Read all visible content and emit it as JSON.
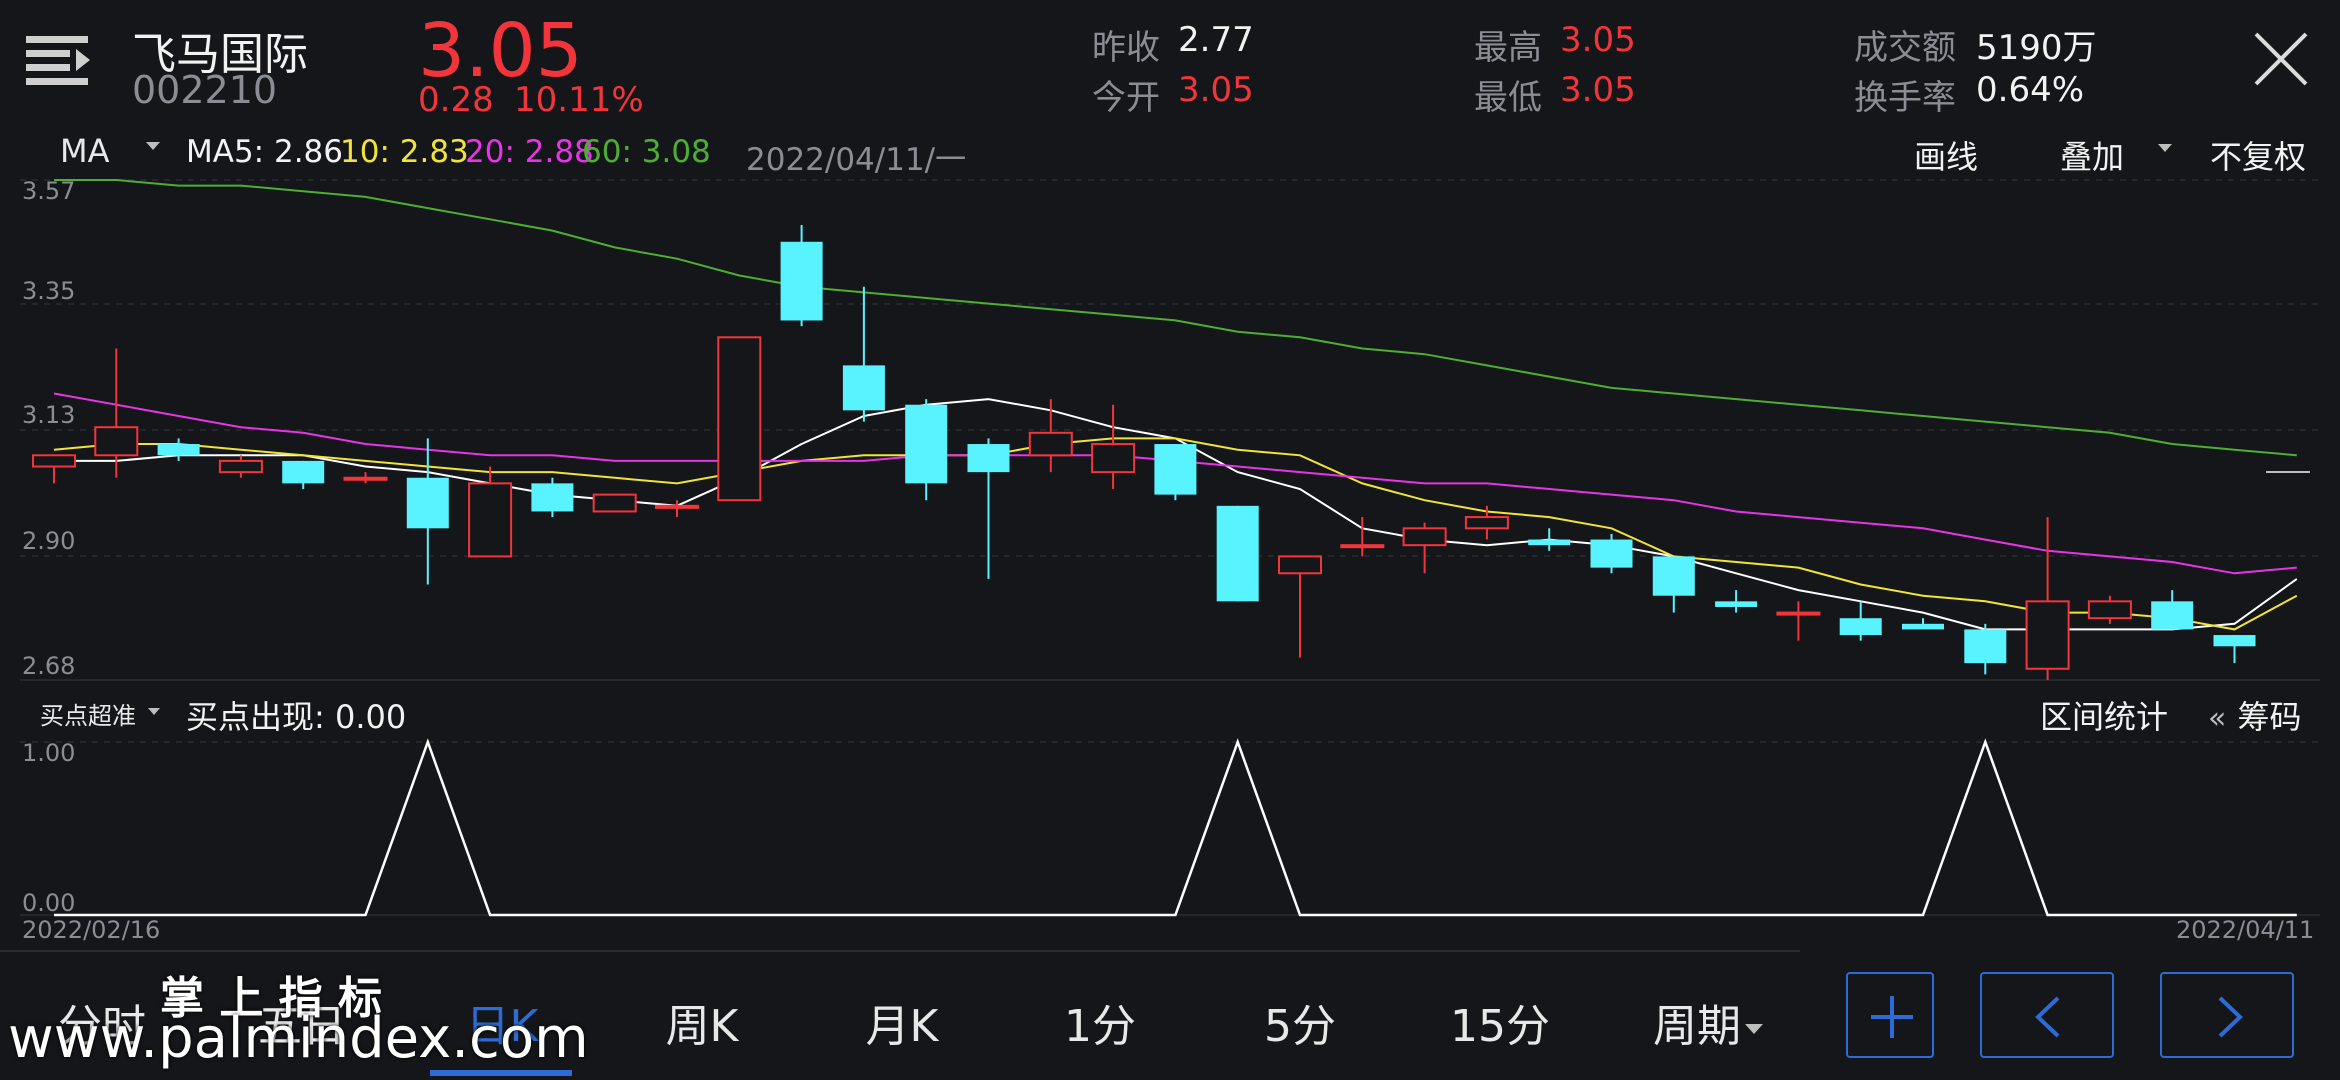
{
  "stock": {
    "name": "飞马国际",
    "code": "002210",
    "price": "3.05",
    "change": "0.28",
    "change_pct": "10.11%"
  },
  "quote": {
    "prev_close_label": "昨收",
    "prev_close": "2.77",
    "open_label": "今开",
    "open": "3.05",
    "high_label": "最高",
    "high": "3.05",
    "low_label": "最低",
    "low": "3.05",
    "amount_label": "成交额",
    "amount": "5190万",
    "turnover_label": "换手率",
    "turnover": "0.64%"
  },
  "toolbar": {
    "indicator": "MA",
    "ma5": "MA5: 2.86",
    "ma10": "10: 2.83",
    "ma20": "20: 2.88",
    "ma60": "60: 3.08",
    "date": "2022/04/11/一",
    "draw_label": "画线",
    "overlay_label": "叠加",
    "adjust_label": "不复权"
  },
  "sub_toolbar": {
    "indicator": "买点超准",
    "value_label": "买点出现: 0.00",
    "range_stats": "区间统计",
    "chips": "筹码",
    "chips_arrow": "«"
  },
  "axis": {
    "y_ticks": [
      "3.57",
      "3.35",
      "3.13",
      "2.90",
      "2.68"
    ],
    "sub_ticks": [
      "1.00",
      "0.00"
    ],
    "start_date": "2022/02/16",
    "end_date": "2022/04/11"
  },
  "tabs": [
    "分时",
    "五日",
    "日K",
    "周K",
    "月K",
    "1分",
    "5分",
    "15分",
    "周期"
  ],
  "active_tab": "日K",
  "watermark": {
    "line1": "掌 上 指 标",
    "line2": "www.palmindex.com"
  },
  "colors": {
    "up": "#f2353a",
    "down": "#59f3ff",
    "ma5": "#ffffff",
    "ma10": "#f0e43a",
    "ma20": "#e635e6",
    "ma60": "#4caf32",
    "accent": "#2d6bd6"
  },
  "chart_data": {
    "type": "candlestick",
    "ylim": [
      2.68,
      3.57
    ],
    "candles": [
      {
        "o": 3.06,
        "h": 3.08,
        "l": 3.03,
        "c": 3.08
      },
      {
        "o": 3.08,
        "h": 3.27,
        "l": 3.04,
        "c": 3.13
      },
      {
        "o": 3.1,
        "h": 3.11,
        "l": 3.07,
        "c": 3.08
      },
      {
        "o": 3.05,
        "h": 3.08,
        "l": 3.04,
        "c": 3.07
      },
      {
        "o": 3.07,
        "h": 3.07,
        "l": 3.02,
        "c": 3.03
      },
      {
        "o": 3.04,
        "h": 3.05,
        "l": 3.03,
        "c": 3.04
      },
      {
        "o": 3.04,
        "h": 3.11,
        "l": 2.85,
        "c": 2.95
      },
      {
        "o": 2.9,
        "h": 3.06,
        "l": 2.9,
        "c": 3.03
      },
      {
        "o": 3.03,
        "h": 3.04,
        "l": 2.97,
        "c": 2.98
      },
      {
        "o": 2.98,
        "h": 3.01,
        "l": 2.98,
        "c": 3.01
      },
      {
        "o": 2.99,
        "h": 3.0,
        "l": 2.97,
        "c": 2.99
      },
      {
        "o": 3.0,
        "h": 3.29,
        "l": 3.0,
        "c": 3.29
      },
      {
        "o": 3.46,
        "h": 3.49,
        "l": 3.31,
        "c": 3.32
      },
      {
        "o": 3.24,
        "h": 3.38,
        "l": 3.14,
        "c": 3.16
      },
      {
        "o": 3.17,
        "h": 3.18,
        "l": 3.0,
        "c": 3.03
      },
      {
        "o": 3.1,
        "h": 3.11,
        "l": 2.86,
        "c": 3.05
      },
      {
        "o": 3.08,
        "h": 3.18,
        "l": 3.05,
        "c": 3.12
      },
      {
        "o": 3.05,
        "h": 3.17,
        "l": 3.02,
        "c": 3.1
      },
      {
        "o": 3.1,
        "h": 3.1,
        "l": 3.0,
        "c": 3.01
      },
      {
        "o": 2.99,
        "h": 2.99,
        "l": 2.82,
        "c": 2.82
      },
      {
        "o": 2.87,
        "h": 2.9,
        "l": 2.72,
        "c": 2.9
      },
      {
        "o": 2.92,
        "h": 2.97,
        "l": 2.9,
        "c": 2.92
      },
      {
        "o": 2.92,
        "h": 2.96,
        "l": 2.87,
        "c": 2.95
      },
      {
        "o": 2.95,
        "h": 2.99,
        "l": 2.93,
        "c": 2.97
      },
      {
        "o": 2.93,
        "h": 2.95,
        "l": 2.91,
        "c": 2.92
      },
      {
        "o": 2.93,
        "h": 2.94,
        "l": 2.87,
        "c": 2.88
      },
      {
        "o": 2.9,
        "h": 2.9,
        "l": 2.8,
        "c": 2.83
      },
      {
        "o": 2.82,
        "h": 2.84,
        "l": 2.8,
        "c": 2.81
      },
      {
        "o": 2.8,
        "h": 2.82,
        "l": 2.75,
        "c": 2.8
      },
      {
        "o": 2.79,
        "h": 2.82,
        "l": 2.75,
        "c": 2.76
      },
      {
        "o": 2.78,
        "h": 2.79,
        "l": 2.77,
        "c": 2.77
      },
      {
        "o": 2.77,
        "h": 2.78,
        "l": 2.69,
        "c": 2.71
      },
      {
        "o": 2.7,
        "h": 2.97,
        "l": 2.68,
        "c": 2.82
      },
      {
        "o": 2.79,
        "h": 2.83,
        "l": 2.78,
        "c": 2.82
      },
      {
        "o": 2.82,
        "h": 2.84,
        "l": 2.77,
        "c": 2.77
      },
      {
        "o": 2.76,
        "h": 2.76,
        "l": 2.71,
        "c": 2.74
      },
      {
        "o": 3.05,
        "h": 3.05,
        "l": 3.05,
        "c": 3.05
      }
    ],
    "series": [
      {
        "name": "MA5",
        "values": [
          3.07,
          3.07,
          3.08,
          3.08,
          3.08,
          3.06,
          3.05,
          3.03,
          3.01,
          3.0,
          2.99,
          3.04,
          3.1,
          3.15,
          3.17,
          3.18,
          3.16,
          3.13,
          3.11,
          3.05,
          3.02,
          2.95,
          2.93,
          2.92,
          2.93,
          2.92,
          2.9,
          2.87,
          2.84,
          2.82,
          2.8,
          2.77,
          2.77,
          2.77,
          2.77,
          2.78,
          2.86
        ]
      },
      {
        "name": "10",
        "values": [
          3.09,
          3.1,
          3.1,
          3.09,
          3.08,
          3.07,
          3.06,
          3.05,
          3.05,
          3.04,
          3.03,
          3.05,
          3.07,
          3.08,
          3.08,
          3.08,
          3.1,
          3.11,
          3.11,
          3.09,
          3.08,
          3.03,
          3.0,
          2.98,
          2.97,
          2.95,
          2.9,
          2.89,
          2.88,
          2.85,
          2.83,
          2.82,
          2.8,
          2.8,
          2.79,
          2.77,
          2.83
        ]
      },
      {
        "name": "20",
        "values": [
          3.19,
          3.17,
          3.15,
          3.13,
          3.12,
          3.1,
          3.09,
          3.08,
          3.08,
          3.07,
          3.07,
          3.07,
          3.07,
          3.07,
          3.08,
          3.08,
          3.08,
          3.08,
          3.07,
          3.06,
          3.05,
          3.04,
          3.03,
          3.03,
          3.02,
          3.01,
          3.0,
          2.98,
          2.97,
          2.96,
          2.95,
          2.93,
          2.91,
          2.9,
          2.89,
          2.87,
          2.88
        ]
      },
      {
        "name": "60",
        "values": [
          3.57,
          3.57,
          3.56,
          3.56,
          3.55,
          3.54,
          3.52,
          3.5,
          3.48,
          3.45,
          3.43,
          3.4,
          3.38,
          3.37,
          3.36,
          3.35,
          3.34,
          3.33,
          3.32,
          3.3,
          3.29,
          3.27,
          3.26,
          3.24,
          3.22,
          3.2,
          3.19,
          3.18,
          3.17,
          3.16,
          3.15,
          3.14,
          3.13,
          3.12,
          3.1,
          3.09,
          3.08
        ]
      }
    ],
    "signal": {
      "name": "买点出现",
      "values": [
        0,
        0,
        0,
        0,
        0,
        0,
        1,
        0,
        0,
        0,
        0,
        0,
        0,
        0,
        0,
        0,
        0,
        0,
        0,
        1,
        0,
        0,
        0,
        0,
        0,
        0,
        0,
        0,
        0,
        0,
        0,
        1,
        0,
        0,
        0,
        0,
        0
      ],
      "ylim": [
        0,
        1
      ]
    }
  }
}
